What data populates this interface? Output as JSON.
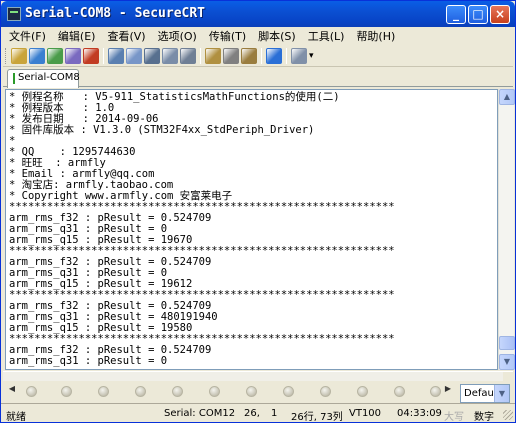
{
  "window": {
    "title": "Serial-COM8 - SecureCRT",
    "minimize": "_",
    "maximize": "□",
    "close": "×"
  },
  "menu": [
    "文件(F)",
    "编辑(E)",
    "查看(V)",
    "选项(O)",
    "传输(T)",
    "脚本(S)",
    "工具(L)",
    "帮助(H)"
  ],
  "toolbar": {
    "icons": [
      "connect-icon",
      "quick-connect-icon",
      "connect-tab-icon",
      "reconnect-icon",
      "disconnect-icon",
      "copy-icon",
      "paste-icon",
      "find-icon",
      "print-setup-icon",
      "print-icon",
      "session-options-icon",
      "global-options-icon",
      "key-map-icon",
      "help-icon",
      "sftp-icon",
      "more-icon"
    ],
    "colors": [
      "#c9a43a",
      "#3a7fd0",
      "#4a9c4a",
      "#7a6ac0",
      "#c23b22",
      "#5a7fb0",
      "#7896c8",
      "#58708f",
      "#7a8da8",
      "#6f7f95",
      "#b09040",
      "#808080",
      "#9a7d3e",
      "#2a6fd6",
      "#8090a8",
      "#404040"
    ]
  },
  "tab": {
    "label": "Serial-COM8"
  },
  "terminal_lines": [
    "* 例程名称   : V5-911_StatisticsMathFunctions的使用(二)",
    "* 例程版本   : 1.0",
    "* 发布日期   : 2014-09-06",
    "* 固件库版本 : V1.3.0 (STM32F4xx_StdPeriph_Driver)",
    "*",
    "* QQ    : 1295744630",
    "* 旺旺  : armfly",
    "* Email : armfly@qq.com",
    "* 淘宝店: armfly.taobao.com",
    "* Copyright www.armfly.com 安富莱电子",
    "*************************************************************",
    "arm_rms_f32 : pResult = 0.524709",
    "arm_rms_q31 : pResult = 0",
    "arm_rms_q15 : pResult = 19670",
    "*************************************************************",
    "arm_rms_f32 : pResult = 0.524709",
    "arm_rms_q31 : pResult = 0",
    "arm_rms_q15 : pResult = 19612",
    "*************************************************************",
    "arm_rms_f32 : pResult = 0.524709",
    "arm_rms_q31 : pResult = 480191940",
    "arm_rms_q15 : pResult = 19580",
    "*************************************************************",
    "arm_rms_f32 : pResult = 0.524709",
    "arm_rms_q31 : pResult = 0"
  ],
  "button_bar": {
    "session_select": "Defau"
  },
  "status": {
    "ready": "就绪",
    "connection": "Serial: COM12",
    "row": "26,",
    "col": "1",
    "rows_cols": "26行, 73列",
    "emulation": "VT100",
    "time": "04:33:09",
    "caps": "大写",
    "num": "数字"
  }
}
